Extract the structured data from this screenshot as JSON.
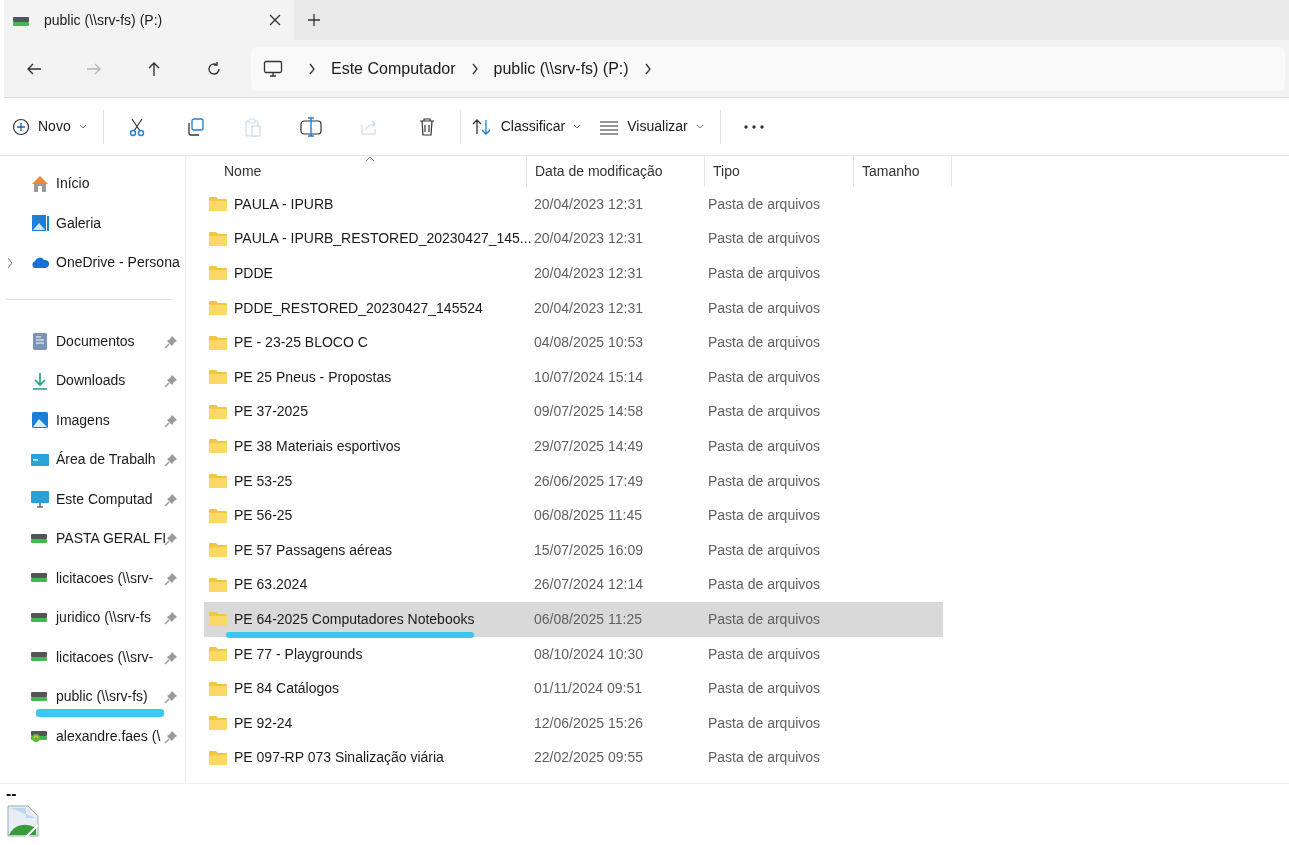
{
  "tab": {
    "title": "public (\\\\srv-fs) (P:)"
  },
  "nav": [
    {
      "kind": "back",
      "disabled": false
    },
    {
      "kind": "forward",
      "disabled": true
    },
    {
      "kind": "up",
      "disabled": false
    },
    {
      "kind": "refresh",
      "disabled": false
    }
  ],
  "breadcrumb": [
    "Este Computador",
    "public (\\\\srv-fs) (P:)"
  ],
  "toolbar": [
    {
      "kind": "new",
      "label": "Novo",
      "disabled": false
    },
    {
      "kind": "cut",
      "disabled": false
    },
    {
      "kind": "copy",
      "disabled": false
    },
    {
      "kind": "paste",
      "disabled": true
    },
    {
      "kind": "rename",
      "disabled": false
    },
    {
      "kind": "share",
      "disabled": true
    },
    {
      "kind": "delete",
      "disabled": false
    },
    {
      "kind": "sort",
      "label": "Classificar",
      "disabled": false
    },
    {
      "kind": "view",
      "label": "Visualizar",
      "disabled": false
    },
    {
      "kind": "more",
      "disabled": false
    }
  ],
  "sidebar": {
    "items": [
      {
        "kind": "home",
        "label": "Início",
        "pinned": false,
        "expandable": false,
        "underlined": false
      },
      {
        "kind": "gallery",
        "label": "Galeria",
        "pinned": false,
        "expandable": false,
        "underlined": false
      },
      {
        "kind": "cloud",
        "label": "OneDrive - Persona",
        "pinned": false,
        "expandable": true,
        "underlined": false
      },
      {
        "kind": "divider"
      },
      {
        "kind": "documents",
        "label": "Documentos",
        "pinned": true,
        "expandable": false,
        "underlined": false
      },
      {
        "kind": "download",
        "label": "Downloads",
        "pinned": true,
        "expandable": false,
        "underlined": false
      },
      {
        "kind": "pictures",
        "label": "Imagens",
        "pinned": true,
        "expandable": false,
        "underlined": false
      },
      {
        "kind": "desktop",
        "label": "Área de Trabalh",
        "pinned": true,
        "expandable": false,
        "underlined": false
      },
      {
        "kind": "computer",
        "label": "Este Computad",
        "pinned": true,
        "expandable": false,
        "underlined": false
      },
      {
        "kind": "drive",
        "label": "PASTA GERAL FI",
        "pinned": true,
        "expandable": false,
        "underlined": false
      },
      {
        "kind": "drive",
        "label": "licitacoes (\\\\srv-",
        "pinned": true,
        "expandable": false,
        "underlined": false
      },
      {
        "kind": "drive",
        "label": "juridico (\\\\srv-fs",
        "pinned": true,
        "expandable": false,
        "underlined": false
      },
      {
        "kind": "drive",
        "label": "licitacoes (\\\\srv-",
        "pinned": true,
        "expandable": false,
        "underlined": false
      },
      {
        "kind": "drive",
        "label": "public (\\\\srv-fs)",
        "pinned": true,
        "expandable": false,
        "underlined": true
      },
      {
        "kind": "user-drive",
        "label": "alexandre.faes (\\",
        "pinned": true,
        "expandable": false,
        "underlined": false
      }
    ]
  },
  "table": {
    "columns": [
      {
        "label": "Nome",
        "sorted": true
      },
      {
        "label": "Data de modificação",
        "sorted": false
      },
      {
        "label": "Tipo",
        "sorted": false
      },
      {
        "label": "Tamanho",
        "sorted": false
      }
    ],
    "rows": [
      {
        "name": "PAULA - IPURB",
        "date": "20/04/2023 12:31",
        "type": "Pasta de arquivos",
        "selected": false,
        "underlined": false
      },
      {
        "name": "PAULA - IPURB_RESTORED_20230427_145...",
        "date": "20/04/2023 12:31",
        "type": "Pasta de arquivos",
        "selected": false,
        "underlined": false
      },
      {
        "name": "PDDE",
        "date": "20/04/2023 12:31",
        "type": "Pasta de arquivos",
        "selected": false,
        "underlined": false
      },
      {
        "name": "PDDE_RESTORED_20230427_145524",
        "date": "20/04/2023 12:31",
        "type": "Pasta de arquivos",
        "selected": false,
        "underlined": false
      },
      {
        "name": "PE - 23-25 BLOCO C",
        "date": "04/08/2025 10:53",
        "type": "Pasta de arquivos",
        "selected": false,
        "underlined": false
      },
      {
        "name": "PE 25 Pneus - Propostas",
        "date": "10/07/2024 15:14",
        "type": "Pasta de arquivos",
        "selected": false,
        "underlined": false
      },
      {
        "name": "PE 37-2025",
        "date": "09/07/2025 14:58",
        "type": "Pasta de arquivos",
        "selected": false,
        "underlined": false
      },
      {
        "name": "PE 38 Materiais esportivos",
        "date": "29/07/2025 14:49",
        "type": "Pasta de arquivos",
        "selected": false,
        "underlined": false
      },
      {
        "name": "PE 53-25",
        "date": "26/06/2025 17:49",
        "type": "Pasta de arquivos",
        "selected": false,
        "underlined": false
      },
      {
        "name": "PE 56-25",
        "date": "06/08/2025 11:45",
        "type": "Pasta de arquivos",
        "selected": false,
        "underlined": false
      },
      {
        "name": "PE 57 Passagens aéreas",
        "date": "15/07/2025 16:09",
        "type": "Pasta de arquivos",
        "selected": false,
        "underlined": false
      },
      {
        "name": "PE 63.2024",
        "date": "26/07/2024 12:14",
        "type": "Pasta de arquivos",
        "selected": false,
        "underlined": false
      },
      {
        "name": "PE 64-2025 Computadores Notebooks",
        "date": "06/08/2025 11:25",
        "type": "Pasta de arquivos",
        "selected": true,
        "underlined": true
      },
      {
        "name": "PE 77 - Playgrounds",
        "date": "08/10/2024 10:30",
        "type": "Pasta de arquivos",
        "selected": false,
        "underlined": false
      },
      {
        "name": "PE 84 Catálogos",
        "date": "01/11/2024 09:51",
        "type": "Pasta de arquivos",
        "selected": false,
        "underlined": false
      },
      {
        "name": "PE 92-24",
        "date": "12/06/2025 15:26",
        "type": "Pasta de arquivos",
        "selected": false,
        "underlined": false
      },
      {
        "name": "PE 097-RP 073 Sinalização viária",
        "date": "22/02/2025 09:55",
        "type": "Pasta de arquivos",
        "selected": false,
        "underlined": false
      }
    ]
  },
  "footer": {
    "text": "--",
    "broken_image": true
  }
}
